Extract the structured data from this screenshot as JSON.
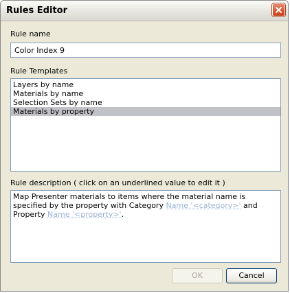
{
  "window": {
    "title": "Rules Editor",
    "close_icon": "close-icon"
  },
  "rule_name": {
    "label": "Rule name",
    "value": "Color Index 9"
  },
  "rule_templates": {
    "label": "Rule Templates",
    "items": [
      "Layers by name",
      "Materials by name",
      "Selection Sets by name",
      "Materials by property"
    ],
    "selected_index": 3
  },
  "rule_description": {
    "label": "Rule description ( click on an underlined value to edit it )",
    "text_1": "Map Presenter materials to items where the material name is specified by the property with Category ",
    "link_1": "Name '<category>'",
    "text_2": " and Property ",
    "link_2": "Name '<property>'",
    "text_3": "."
  },
  "buttons": {
    "ok": "OK",
    "cancel": "Cancel"
  }
}
